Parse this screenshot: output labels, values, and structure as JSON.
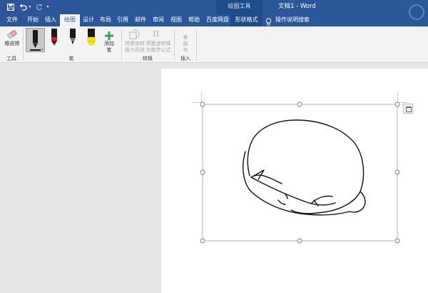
{
  "window": {
    "context_tab_header": "绘图工具",
    "doc_title": "文档1 - Word"
  },
  "tabs": [
    {
      "label": "文件"
    },
    {
      "label": "开始"
    },
    {
      "label": "插入"
    },
    {
      "label": "绘图"
    },
    {
      "label": "设计"
    },
    {
      "label": "布局"
    },
    {
      "label": "引用"
    },
    {
      "label": "邮件"
    },
    {
      "label": "审阅"
    },
    {
      "label": "视图"
    },
    {
      "label": "帮助"
    },
    {
      "label": "百度网盘"
    },
    {
      "label": "形状格式"
    }
  ],
  "tell_me": "操作说明搜索",
  "ribbon": {
    "eraser_label": "橡皮擦",
    "tools_group": "工具",
    "add_pen_label_line1": "添加",
    "add_pen_label_line2": "笔",
    "pens_group": "笔",
    "ink_to_shape_line1": "将墨迹转",
    "ink_to_shape_line2": "换为形状",
    "ink_to_math_line1": "将墨迹转换",
    "ink_to_math_line2": "为数学公式",
    "convert_group": "转换",
    "canvas_line1": "画",
    "canvas_line2": "布",
    "insert_group": "插入"
  },
  "colors": {
    "title_bar": "#2b579a",
    "context_tab": "#1e4b8a",
    "ribbon_bg": "#f3f3f3",
    "canvas_bg": "#e6e6e6",
    "pen_black": "#1a1a1a",
    "pen_red": "#e0182d",
    "pen_highlighter": "#ffe600",
    "add_pen_plus": "#3c9d5d"
  },
  "icons": {
    "save": "save-icon",
    "undo": "undo-icon",
    "redo": "redo-icon",
    "customize": "customize-qat-icon",
    "tell_me": "lightbulb-icon"
  }
}
